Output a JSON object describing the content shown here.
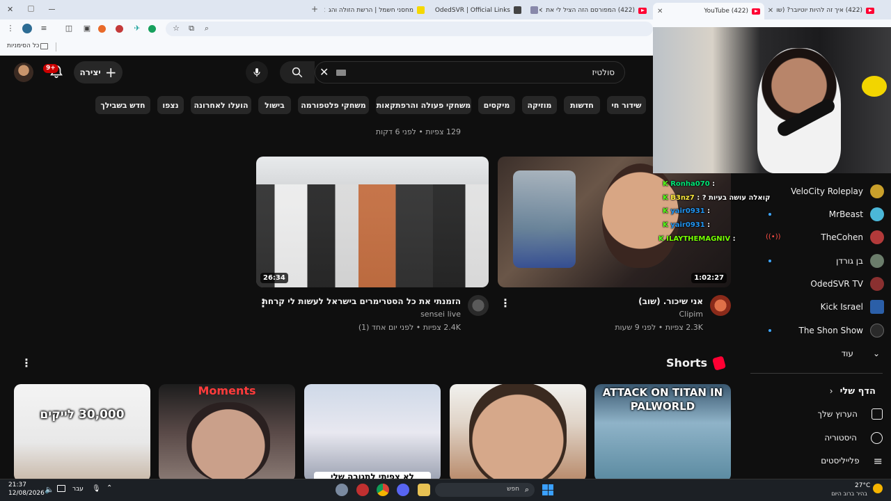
{
  "browser": {
    "tabs": [
      {
        "title": "(422) איך זה להיות יוטיובר? (שו"
      },
      {
        "title": "(422) YouTube"
      },
      {
        "title": "(422) המפורסם הזה הציל לי את"
      },
      {
        "title": ""
      },
      {
        "title": "OdedSVR | Official Links"
      },
      {
        "title": "מחסני חשמל | הרשת הזולה והג"
      }
    ],
    "new_tab": "+",
    "bookmarks_label": "כל הסימניות"
  },
  "youtube": {
    "search_query": "סולטיז",
    "create_label": "יצירה",
    "notifications_count": "9+",
    "chips": [
      "שידור חי",
      "חדשות",
      "מוזיקה",
      "מיקסים",
      "משחקי פעולה והרפתקאות",
      "משחקי פלטפורמה",
      "בישול",
      "הועלו לאחרונה",
      "נצפו",
      "חדש בשבילך"
    ],
    "prev_row": {
      "meta_views": "129 צפיות • לפני 6 דקות"
    },
    "videos": [
      {
        "title": "אני שיכור. (שוב)",
        "channel": "Clipim",
        "meta": "2.3K צפיות • לפני 9 שעות",
        "duration": "1:02:27"
      },
      {
        "title": "הזמנתי את כל הסטרימרים בישראל לעשות לי קרחת",
        "channel": "sensei live",
        "meta": "2.4K צפיות • לפני יום אחד (1)",
        "duration": "26:34"
      }
    ],
    "shorts_title": "Shorts",
    "shorts": [
      {
        "overlay": "ATTACK ON TITAN IN PALWORLD"
      },
      {
        "overlay": ""
      },
      {
        "overlay": "לא צפיתי לתגובה שלי"
      },
      {
        "overlay": "Moments"
      },
      {
        "overlay": "30,000 לייקים"
      }
    ],
    "sidebar": {
      "subscriptions": [
        {
          "name": "VeloCity Roleplay",
          "color": "#c9a02b"
        },
        {
          "name": "MrBeast",
          "color": "#4bb7d8"
        },
        {
          "name": "TheCohen",
          "color": "#b23a3a"
        },
        {
          "name": "בן גורדן",
          "color": "#6b7d6b"
        },
        {
          "name": "OdedSVR TV",
          "color": "#8a3030"
        },
        {
          "name": "Kick Israel",
          "color": "#2b5fa8"
        },
        {
          "name": "The Shon Show",
          "color": "#2a2a2a"
        }
      ],
      "more_label": "עוד",
      "you_label": "הדף שלי",
      "you_items": [
        {
          "label": "הערוץ שלך"
        },
        {
          "label": "היסטוריה"
        },
        {
          "label": "פלייליסטים"
        }
      ]
    }
  },
  "stream_chat": [
    {
      "user": "Ronha070",
      "text": "",
      "color": "#00e676"
    },
    {
      "user": "B3nz7",
      "text": "? קואלה עושה בעיות",
      "color": "#ffeb3b"
    },
    {
      "user": "yair0931",
      "text": "",
      "color": "#2196f3"
    },
    {
      "user": "yair0931",
      "text": "",
      "color": "#2196f3"
    },
    {
      "user": "ILAYTHEMAGNIV",
      "text": "",
      "color": "#76ff03"
    }
  ],
  "taskbar": {
    "time": "21:37",
    "date": "12/08/2026",
    "lang": "עבר",
    "search": "חפש",
    "weather_temp": "27°C",
    "weather_desc": "בהיר ברוב היום"
  }
}
